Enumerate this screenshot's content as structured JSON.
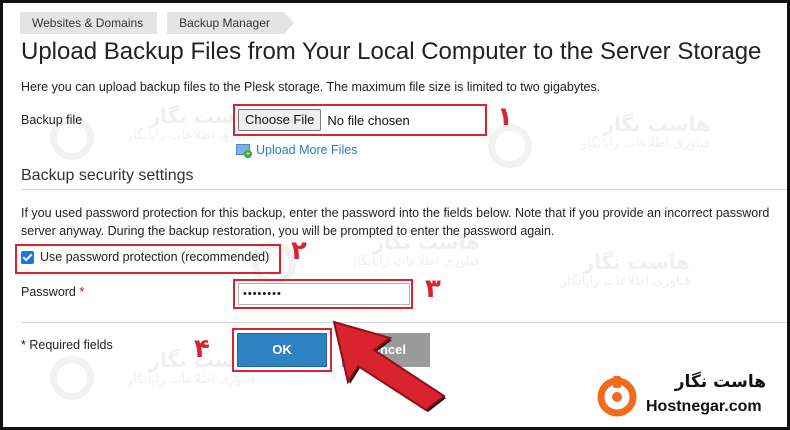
{
  "breadcrumb": [
    "Websites & Domains",
    "Backup Manager"
  ],
  "page_title": "Upload Backup Files from Your Local Computer to the Server Storage",
  "intro_text": "Here you can upload backup files to the Plesk storage. The maximum file size is limited to two gigabytes.",
  "backup_file": {
    "label": "Backup file",
    "choose_button": "Choose File",
    "status": "No file chosen"
  },
  "upload_more_link": "Upload More Files",
  "security_section": {
    "title": "Backup security settings",
    "description_line1": "If you used password protection for this backup, enter the password into the fields below. Note that if you provide an incorrect password",
    "description_line2": "server anyway. During the backup restoration, you will be prompted to enter the password again.",
    "checkbox_label": "Use password protection (recommended)",
    "checkbox_checked": true,
    "password_label": "Password",
    "required_star": "*",
    "password_value": "••••••••"
  },
  "required_note": "* Required fields",
  "buttons": {
    "ok": "OK",
    "cancel": "Cancel"
  },
  "annotation_numbers": [
    "۱",
    "۲",
    "۳",
    "۴"
  ],
  "watermark": {
    "line1": "هاست نگار",
    "line2": "فناوری اطلاعات رایانگار"
  },
  "brand": {
    "name_fa": "هاست نگار",
    "name_en": "Hostnegar.com"
  },
  "colors": {
    "accent_red": "#d9232e",
    "ok_blue": "#2f83c3",
    "link_blue": "#2b7bc0",
    "brand_orange": "#f26a1b"
  }
}
